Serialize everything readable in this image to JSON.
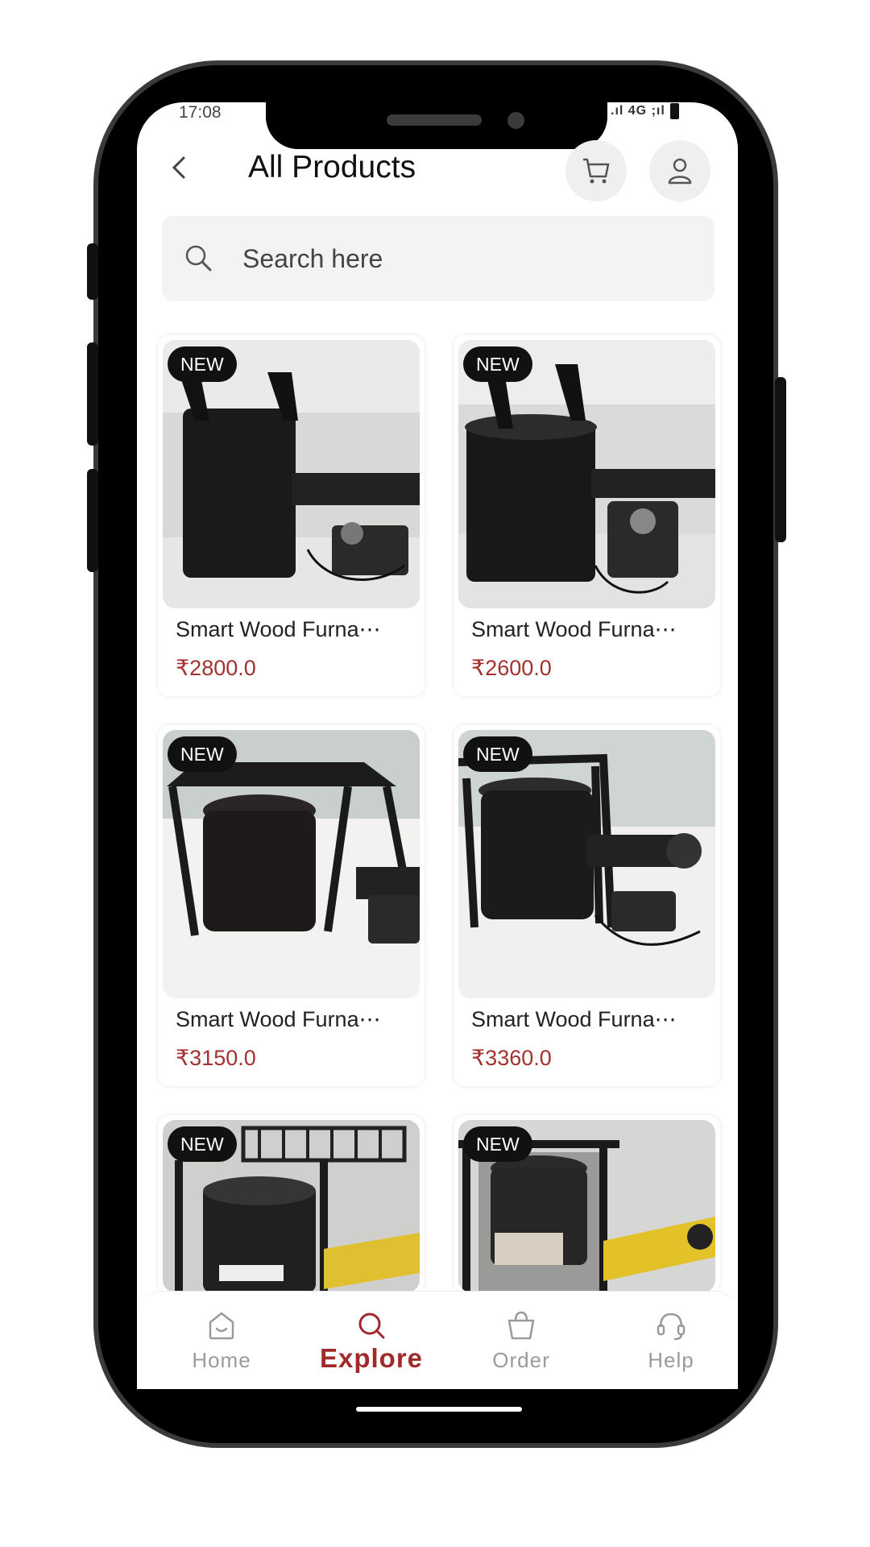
{
  "status_bar": {
    "time": "17:08",
    "indicators": ".ıl 4G ;ıl"
  },
  "header": {
    "title": "All Products",
    "back_icon": "chevron-left-icon",
    "cart_icon": "cart-icon",
    "profile_icon": "user-icon"
  },
  "search": {
    "placeholder": "Search here",
    "icon": "search-icon"
  },
  "products": [
    {
      "badge": "NEW",
      "name": "Smart Wood Furna⋯",
      "price": "₹2800.0"
    },
    {
      "badge": "NEW",
      "name": "Smart Wood Furna⋯",
      "price": "₹2600.0"
    },
    {
      "badge": "NEW",
      "name": "Smart Wood Furna⋯",
      "price": "₹3150.0"
    },
    {
      "badge": "NEW",
      "name": "Smart Wood Furna⋯",
      "price": "₹3360.0"
    },
    {
      "badge": "NEW",
      "name": "",
      "price": ""
    },
    {
      "badge": "NEW",
      "name": "",
      "price": ""
    }
  ],
  "bottom_nav": {
    "active": "Explore",
    "items": [
      {
        "label": "Home",
        "icon": "home-icon"
      },
      {
        "label": "Explore",
        "icon": "search-icon"
      },
      {
        "label": "Order",
        "icon": "bag-icon"
      },
      {
        "label": "Help",
        "icon": "headset-icon"
      }
    ]
  },
  "colors": {
    "accent": "#a43030",
    "badge_bg": "#111111",
    "search_bg": "#f3f3f3"
  }
}
